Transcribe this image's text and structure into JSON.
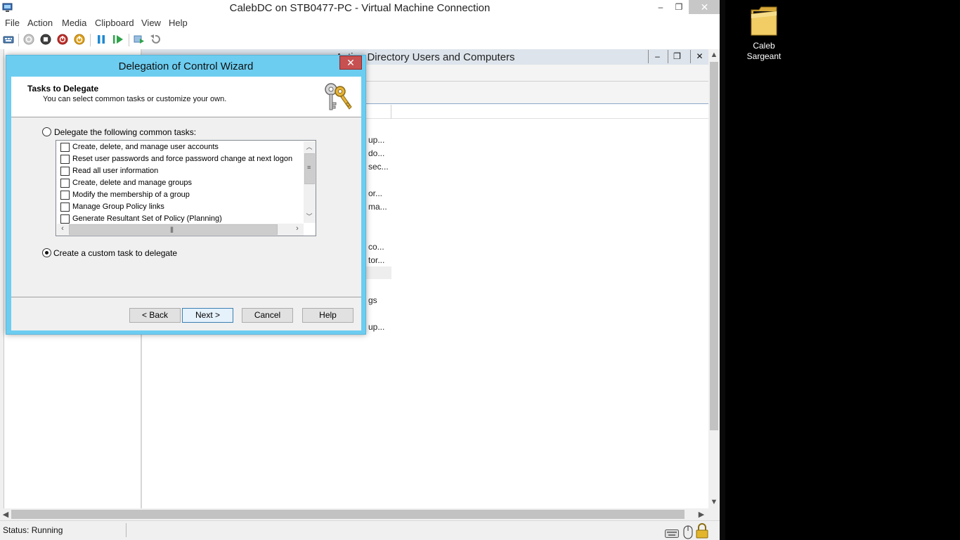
{
  "vm_window": {
    "title": "CalebDC on STB0477-PC - Virtual Machine Connection",
    "controls": {
      "minimize": "–",
      "restore": "❐",
      "close": "✕"
    },
    "menus": [
      "File",
      "Action",
      "Media",
      "Clipboard",
      "View",
      "Help"
    ],
    "toolbar": [
      "ctrl-alt-del-icon",
      "start-icon",
      "turn-off-icon",
      "shut-down-icon",
      "save-icon",
      "pause-icon",
      "resume-icon",
      "snapshot-icon",
      "revert-icon"
    ],
    "status": "Status: Running"
  },
  "aduc": {
    "title_left": "Active Directory Users and Computers",
    "controls": {
      "minimize": "–",
      "restore": "❐",
      "close": "✕"
    },
    "descriptions": [
      "up...",
      "do...",
      "sec...",
      "or...",
      "ma...",
      "co...",
      "tor...",
      "gs",
      "up..."
    ]
  },
  "wizard": {
    "title": "Delegation of Control Wizard",
    "close": "✕",
    "header_title": "Tasks to Delegate",
    "header_subtitle": "You can select common tasks or customize your own.",
    "option_common": "Delegate the following common tasks:",
    "option_custom": "Create a custom task to delegate",
    "selected_option": "custom",
    "tasks": [
      "Create, delete, and manage user accounts",
      "Reset user passwords and force password change at next logon",
      "Read all user information",
      "Create, delete and manage groups",
      "Modify the membership of a group",
      "Manage Group Policy links",
      "Generate Resultant Set of Policy (Planning)"
    ],
    "buttons": {
      "back": "< Back",
      "next": "Next >",
      "cancel": "Cancel",
      "help": "Help"
    }
  },
  "desktop": {
    "folder_label_line1": "Caleb",
    "folder_label_line2": "Sargeant"
  },
  "colors": {
    "wizard_frame": "#6ccdf0",
    "close_red": "#c75050"
  }
}
